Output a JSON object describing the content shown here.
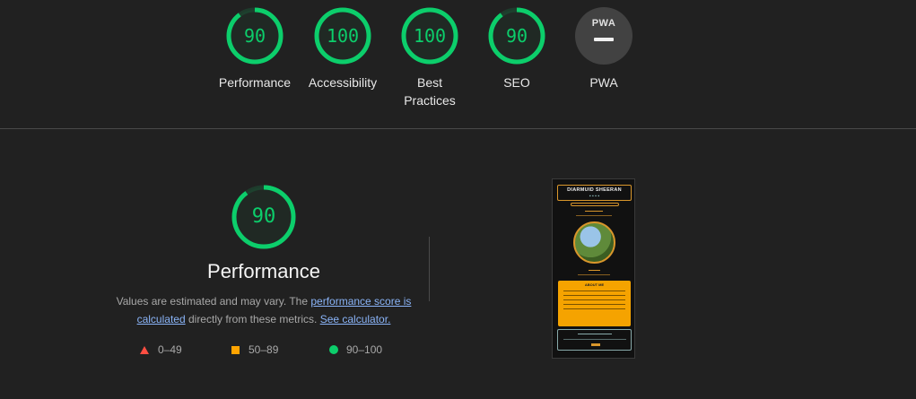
{
  "categories": [
    {
      "id": "performance",
      "score": "90",
      "label": "Performance",
      "fraction": 0.9
    },
    {
      "id": "accessibility",
      "score": "100",
      "label": "Accessibility",
      "fraction": 1.0
    },
    {
      "id": "best-practices",
      "score": "100",
      "label": "Best Practices",
      "fraction": 1.0
    },
    {
      "id": "seo",
      "score": "90",
      "label": "SEO",
      "fraction": 0.9
    }
  ],
  "pwa": {
    "badge": "PWA",
    "label": "PWA"
  },
  "detail": {
    "score": "90",
    "score_fraction": 0.9,
    "title": "Performance",
    "desc_1": "Values are estimated and may vary. The ",
    "link_score": "performance score is calculated",
    "desc_2": " directly from these metrics. ",
    "link_calc": "See calculator."
  },
  "legend": {
    "fail": "0–49",
    "average": "50–89",
    "pass": "90–100"
  },
  "screenshot": {
    "site_name": "DIARMUID SHEERAN",
    "about_title": "ABOUT ME"
  },
  "colors": {
    "pass": "#0cce6b",
    "average": "#ffa400",
    "fail": "#ff4e42",
    "background": "#212121"
  }
}
